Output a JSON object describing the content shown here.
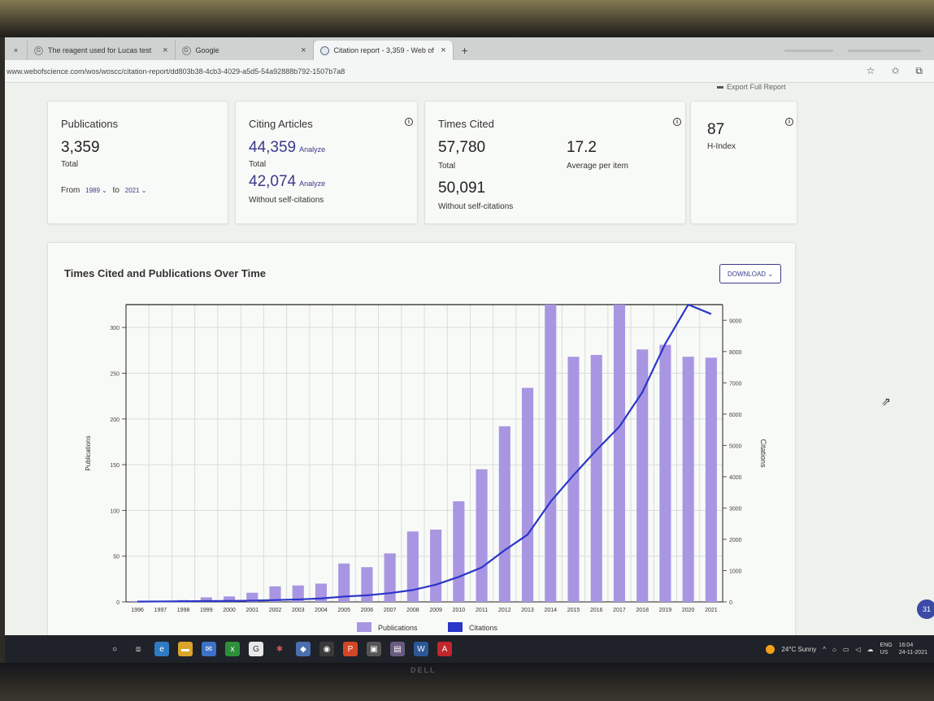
{
  "browser": {
    "tabs": [
      {
        "label": "The reagent used for Lucas test",
        "active": false
      },
      {
        "label": "Google",
        "active": false
      },
      {
        "label": "Citation report - 3,359 - Web of",
        "active": true
      }
    ],
    "url": "www.webofscience.com/wos/woscc/citation-report/dd803b38-4cb3-4029-a5d5-54a92888b792-1507b7a8",
    "new_tab": "+",
    "close": "×"
  },
  "header": {
    "export_fragment": "Export Full Report"
  },
  "cards": {
    "publications": {
      "title": "Publications",
      "value": "3,359",
      "sub": "Total",
      "from_label": "From",
      "from_year": "1989",
      "to_label": "to",
      "to_year": "2021"
    },
    "citing": {
      "title": "Citing Articles",
      "value": "44,359",
      "analyze": "Analyze",
      "sub": "Total",
      "value2": "42,074",
      "analyze2": "Analyze",
      "sub2": "Without self-citations"
    },
    "times_cited": {
      "title": "Times Cited",
      "value": "57,780",
      "sub": "Total",
      "avg": "17.2",
      "avg_label": "Average per item",
      "value2": "50,091",
      "sub2": "Without self-citations"
    },
    "hindex": {
      "value": "87",
      "label": "H-Index"
    }
  },
  "chart": {
    "title": "Times Cited and Publications Over Time",
    "download": "DOWNLOAD"
  },
  "chart_data": {
    "type": "bar",
    "categories": [
      "1996",
      "1997",
      "1998",
      "1999",
      "2000",
      "2001",
      "2002",
      "2003",
      "2004",
      "2005",
      "2006",
      "2007",
      "2008",
      "2009",
      "2010",
      "2011",
      "2012",
      "2013",
      "2014",
      "2015",
      "2016",
      "2017",
      "2018",
      "2019",
      "2020",
      "2021"
    ],
    "series": [
      {
        "name": "Publications",
        "type": "bar",
        "axis": "left",
        "color": "#a996e2",
        "values": [
          1,
          1,
          2,
          5,
          6,
          10,
          17,
          18,
          20,
          42,
          38,
          53,
          77,
          79,
          110,
          145,
          192,
          234,
          325,
          268,
          270,
          326,
          276,
          281,
          268,
          267
        ]
      },
      {
        "name": "Citations",
        "type": "line",
        "axis": "right",
        "color": "#2b35c8",
        "values": [
          10,
          15,
          20,
          25,
          30,
          40,
          60,
          80,
          110,
          170,
          210,
          280,
          380,
          550,
          800,
          1100,
          1650,
          2150,
          3200,
          4050,
          4850,
          5600,
          6700,
          8250,
          9500,
          9200
        ]
      }
    ],
    "ylabel": "Publications",
    "y2label": "Citations",
    "ylim": [
      0,
      325
    ],
    "y2lim": [
      0,
      9500
    ],
    "yticks": [
      0,
      50,
      100,
      150,
      200,
      250,
      300
    ],
    "y2ticks": [
      0,
      1000,
      2000,
      3000,
      4000,
      5000,
      6000,
      7000,
      8000,
      9000
    ],
    "grid": true,
    "legend": "bottom"
  },
  "taskbar": {
    "weather": "24°C Sunny",
    "lang": "ENG",
    "region": "US",
    "time": "16:04",
    "date": "24-11-2021"
  },
  "badge": "31",
  "brand": "DELL"
}
